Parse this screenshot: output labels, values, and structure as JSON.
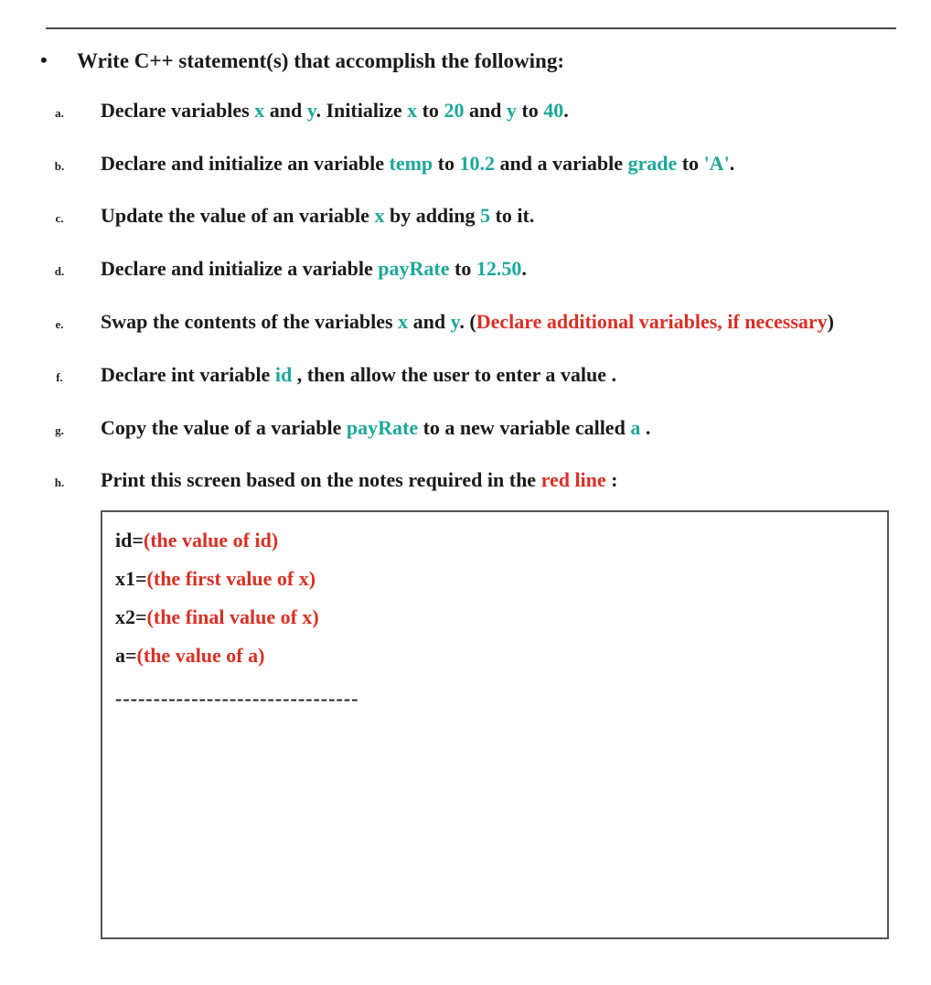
{
  "main": {
    "bullet": "•",
    "heading": "Write C++ statement(s) that accomplish the following:"
  },
  "items": {
    "a": {
      "marker": "a.",
      "t0": "Declare variables ",
      "t1": "x",
      "t2": " and ",
      "t3": "y",
      "t4": ". Initialize ",
      "t5": "x",
      "t6": " to ",
      "t7": "20",
      "t8": " and ",
      "t9": "y",
      "t10": " to ",
      "t11": "40",
      "t12": "."
    },
    "b": {
      "marker": "b.",
      "t0": "Declare and initialize an variable ",
      "t1": "temp",
      "t2": " to ",
      "t3": "10.2",
      "t4": " and a variable ",
      "t5": "grade",
      "t6": " to ",
      "t7": "'A'",
      "t8": "."
    },
    "c": {
      "marker": "c.",
      "t0": "Update the value of an variable ",
      "t1": "x",
      "t2": " by adding ",
      "t3": "5",
      "t4": " to it."
    },
    "d": {
      "marker": "d.",
      "t0": "Declare and initialize a variable ",
      "t1": "payRate",
      "t2": " to ",
      "t3": "12.50",
      "t4": "."
    },
    "e": {
      "marker": "e.",
      "t0": "Swap the contents of the variables ",
      "t1": "x",
      "t2": " and ",
      "t3": "y",
      "t4": ". (",
      "t5": "Declare additional variables, if necessary",
      "t6": ")"
    },
    "f": {
      "marker": "f.",
      "t0": "Declare int variable ",
      "t1": "id",
      "t2": " , then allow the user to enter a value  ."
    },
    "g": {
      "marker": "g.",
      "t0": "Copy the value of a variable ",
      "t1": "payRate",
      "t2": "  to a new variable called ",
      "t3": "a",
      "t4": " ."
    },
    "h": {
      "marker": "h.",
      "t0": "Print this screen based on the notes required in the ",
      "t1": "red line",
      "t2": " :"
    }
  },
  "output": {
    "l1a": "id=",
    "l1b": "(the value of id)",
    "l2a": "x1=",
    "l2b": "(the first value of x)",
    "l3a": "x2=",
    "l3b": "(the final value of x)",
    "l4a": "a=",
    "l4b": "(the value of a)",
    "dashes": "--------------------------------"
  }
}
